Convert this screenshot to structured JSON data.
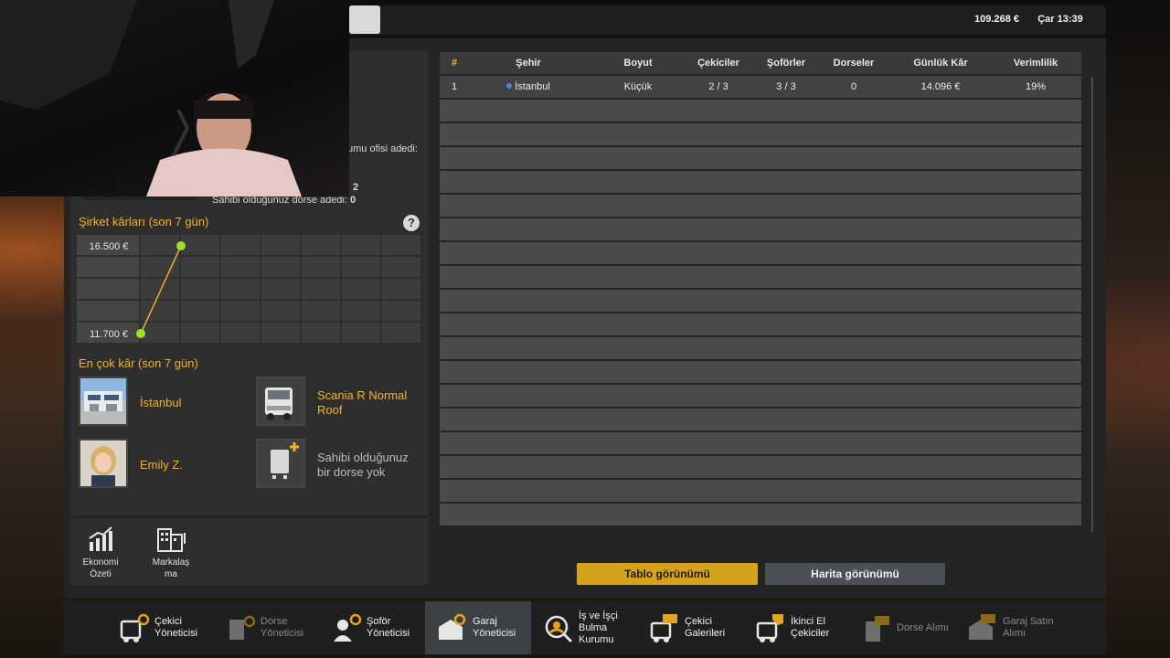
{
  "topbar": {
    "money": "109.268 €",
    "time": "Çar 13:39"
  },
  "company_stats": {
    "office_label": "umu ofisi adedi:",
    "value2": "2",
    "trailer_label": "Sahibi olduğunuz dorse adedi:",
    "trailer_value": "0"
  },
  "profit_chart": {
    "title": "Şirket kârları (son 7 gün)",
    "help": "?"
  },
  "chart_data": {
    "type": "line",
    "title": "Şirket kârları (son 7 gün)",
    "y_ticks": [
      "16.500 €",
      "11.700 €"
    ],
    "ylim": [
      11700,
      16500
    ],
    "x": [
      1,
      2
    ],
    "values": [
      11700,
      16500
    ],
    "color": "#f2b32a",
    "point_color": "#9be22a"
  },
  "top_profit": {
    "title": "En çok kâr (son 7 gün)",
    "city": "İstanbul",
    "truck_line1": "Scania R Normal",
    "truck_line2": "Roof",
    "driver": "Emily Z.",
    "trailer_line1": "Sahibi olduğunuz",
    "trailer_line2": "bir dorse yok"
  },
  "left_menu": {
    "economy_line1": "Ekonomi",
    "economy_line2": "Özeti",
    "brand_line1": "Markalaş",
    "brand_line2": "ma"
  },
  "table": {
    "headers": [
      "#",
      "Şehir",
      "Boyut",
      "Çekiciler",
      "Şoförler",
      "Dorseler",
      "Günlük Kâr",
      "Verimlilik"
    ],
    "rows": [
      {
        "num": "1",
        "city": "İstanbul",
        "size": "Küçük",
        "trucks": "2 / 3",
        "drivers": "3 / 3",
        "trailers": "0",
        "profit": "14.096 €",
        "efficiency": "19%"
      }
    ]
  },
  "view_buttons": {
    "table": "Tablo görünümü",
    "map": "Harita görünümü"
  },
  "nav": [
    {
      "line1": "Çekici",
      "line2": "Yöneticisi",
      "line3": ""
    },
    {
      "line1": "Dorse",
      "line2": "Yöneticisi",
      "line3": ""
    },
    {
      "line1": "Şoför",
      "line2": "Yöneticisi",
      "line3": ""
    },
    {
      "line1": "Garaj",
      "line2": "Yöneticisi",
      "line3": ""
    },
    {
      "line1": "İş ve İşçi",
      "line2": "Bulma",
      "line3": "Kurumu"
    },
    {
      "line1": "Çekici",
      "line2": "Galerileri",
      "line3": ""
    },
    {
      "line1": "İkinci El",
      "line2": "Çekiciler",
      "line3": ""
    },
    {
      "line1": "Dorse Alımı",
      "line2": "",
      "line3": ""
    },
    {
      "line1": "Garaj Satın",
      "line2": "Alımı",
      "line3": ""
    }
  ],
  "colors": {
    "accent": "#f2b32a",
    "primary_button": "#d6a21b",
    "secondary_button": "#4a5055",
    "active_nav": "#3c4146"
  }
}
